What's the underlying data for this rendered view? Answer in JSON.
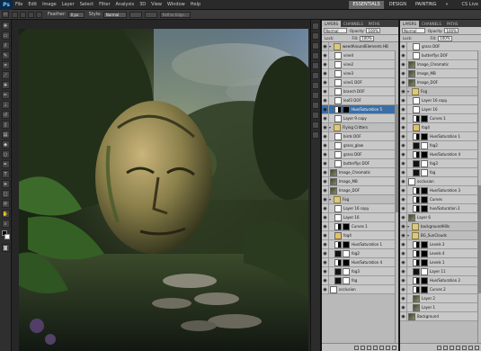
{
  "app": {
    "logo": "Ps",
    "menus": [
      "File",
      "Edit",
      "Image",
      "Layer",
      "Select",
      "Filter",
      "Analysis",
      "3D",
      "View",
      "Window",
      "Help"
    ],
    "workspaces": [
      "ESSENTIALS",
      "DESIGN",
      "PAINTING"
    ],
    "active_workspace": "ESSENTIALS",
    "cslive": "CS Live"
  },
  "options_bar": {
    "feather_label": "Feather:",
    "feather_value": "0 px",
    "style_label": "Style:",
    "style_value": "Normal",
    "refine_label": "Refine Edge..."
  },
  "panel_left": {
    "tabs": [
      "LAYERS",
      "CHANNELS",
      "PATHS"
    ],
    "blend_mode": "Normal",
    "opacity_label": "Opacity:",
    "opacity_value": "100%",
    "lock_label": "Lock:",
    "fill_label": "Fill:",
    "fill_value": "100%",
    "layers": [
      {
        "name": "weedAroundElements HB",
        "kind": "group",
        "depth": 0,
        "thumb": "folder"
      },
      {
        "name": "vine4",
        "kind": "layer",
        "depth": 1,
        "thumb": "white"
      },
      {
        "name": "vine2",
        "kind": "layer",
        "depth": 1,
        "thumb": "white"
      },
      {
        "name": "vine3",
        "kind": "layer",
        "depth": 1,
        "thumb": "white"
      },
      {
        "name": "vine1 DOF",
        "kind": "layer",
        "depth": 1,
        "thumb": "white"
      },
      {
        "name": "branch DOF",
        "kind": "layer",
        "depth": 1,
        "thumb": "white"
      },
      {
        "name": "leaf3 DOF",
        "kind": "layer",
        "depth": 1,
        "thumb": "white"
      },
      {
        "name": "Hue/Saturation 5",
        "kind": "adjust",
        "depth": 1,
        "thumb": "adj",
        "selected": true
      },
      {
        "name": "Layer 9 copy",
        "kind": "layer",
        "depth": 1,
        "thumb": "white"
      },
      {
        "name": "Flying Critters",
        "kind": "group",
        "depth": 0,
        "thumb": "folder"
      },
      {
        "name": "birds DOF",
        "kind": "layer",
        "depth": 1,
        "thumb": "white"
      },
      {
        "name": "grass_glow",
        "kind": "layer",
        "depth": 1,
        "thumb": "white"
      },
      {
        "name": "grass DOF",
        "kind": "layer",
        "depth": 1,
        "thumb": "white"
      },
      {
        "name": "butterflys DOF",
        "kind": "layer",
        "depth": 1,
        "thumb": "white"
      },
      {
        "name": "Image_Chromatic",
        "kind": "layer",
        "depth": 0,
        "thumb": "img"
      },
      {
        "name": "Image_MB",
        "kind": "layer",
        "depth": 0,
        "thumb": "img"
      },
      {
        "name": "Image_DOF",
        "kind": "layer",
        "depth": 0,
        "thumb": "img"
      },
      {
        "name": "Fog",
        "kind": "group",
        "depth": 0,
        "thumb": "folder"
      },
      {
        "name": "Layer 16 copy",
        "kind": "layer",
        "depth": 1,
        "thumb": "white"
      },
      {
        "name": "Layer 16",
        "kind": "layer",
        "depth": 1,
        "thumb": "white"
      },
      {
        "name": "Curves 1",
        "kind": "adjust",
        "depth": 1,
        "thumb": "adj"
      },
      {
        "name": "fog4",
        "kind": "layer",
        "depth": 1,
        "thumb": "yellow"
      },
      {
        "name": "Hue/Saturation 1",
        "kind": "adjust",
        "depth": 1,
        "thumb": "adj"
      },
      {
        "name": "fog2",
        "kind": "layer",
        "depth": 1,
        "thumb": "black"
      },
      {
        "name": "Hue/Saturation 4",
        "kind": "adjust",
        "depth": 1,
        "thumb": "adj"
      },
      {
        "name": "fog3",
        "kind": "layer",
        "depth": 1,
        "thumb": "black"
      },
      {
        "name": "fog",
        "kind": "layer",
        "depth": 1,
        "thumb": "black"
      },
      {
        "name": "occlusion",
        "kind": "layer",
        "depth": 0,
        "thumb": "white"
      }
    ]
  },
  "panel_right": {
    "tabs": [
      "LAYERS",
      "CHANNELS",
      "PATHS"
    ],
    "blend_mode": "Normal",
    "opacity_label": "Opacity:",
    "opacity_value": "100%",
    "lock_label": "Lock:",
    "fill_label": "Fill:",
    "fill_value": "100%",
    "layers": [
      {
        "name": "grass DOF",
        "kind": "layer",
        "depth": 1,
        "thumb": "white"
      },
      {
        "name": "butterflys DOF",
        "kind": "layer",
        "depth": 1,
        "thumb": "white"
      },
      {
        "name": "Image_Chromatic",
        "kind": "layer",
        "depth": 0,
        "thumb": "img"
      },
      {
        "name": "Image_MB",
        "kind": "layer",
        "depth": 0,
        "thumb": "img"
      },
      {
        "name": "Image_DOF",
        "kind": "layer",
        "depth": 0,
        "thumb": "img"
      },
      {
        "name": "Fog",
        "kind": "group",
        "depth": 0,
        "thumb": "folder"
      },
      {
        "name": "Layer 16 copy",
        "kind": "layer",
        "depth": 1,
        "thumb": "white"
      },
      {
        "name": "Layer 16",
        "kind": "layer",
        "depth": 1,
        "thumb": "white"
      },
      {
        "name": "Curves 1",
        "kind": "adjust",
        "depth": 1,
        "thumb": "adj"
      },
      {
        "name": "fog4",
        "kind": "layer",
        "depth": 1,
        "thumb": "yellow"
      },
      {
        "name": "Hue/Saturation 1",
        "kind": "adjust",
        "depth": 1,
        "thumb": "adj"
      },
      {
        "name": "fog2",
        "kind": "layer",
        "depth": 1,
        "thumb": "black"
      },
      {
        "name": "Hue/Saturation 4",
        "kind": "adjust",
        "depth": 1,
        "thumb": "adj"
      },
      {
        "name": "fog3",
        "kind": "layer",
        "depth": 1,
        "thumb": "black"
      },
      {
        "name": "fog",
        "kind": "layer",
        "depth": 1,
        "thumb": "black"
      },
      {
        "name": "occlusion",
        "kind": "layer",
        "depth": 0,
        "thumb": "white"
      },
      {
        "name": "Hue/Saturation 3",
        "kind": "adjust",
        "depth": 1,
        "thumb": "adj"
      },
      {
        "name": "Curves",
        "kind": "adjust",
        "depth": 1,
        "thumb": "adj"
      },
      {
        "name": "hue/Saturation 2",
        "kind": "adjust",
        "depth": 1,
        "thumb": "adj"
      },
      {
        "name": "Layer 6",
        "kind": "layer",
        "depth": 0,
        "thumb": "img"
      },
      {
        "name": "backgroundHills",
        "kind": "group",
        "depth": 0,
        "thumb": "folder"
      },
      {
        "name": "BG_SunClouds",
        "kind": "group",
        "depth": 0,
        "thumb": "folder"
      },
      {
        "name": "Levels 3",
        "kind": "adjust",
        "depth": 1,
        "thumb": "adj"
      },
      {
        "name": "Levels 4",
        "kind": "adjust",
        "depth": 1,
        "thumb": "adj"
      },
      {
        "name": "Levels 1",
        "kind": "adjust",
        "depth": 1,
        "thumb": "adj"
      },
      {
        "name": "Layer 11",
        "kind": "layer",
        "depth": 1,
        "thumb": "black"
      },
      {
        "name": "Hue/Saturation 2",
        "kind": "adjust",
        "depth": 1,
        "thumb": "adj"
      },
      {
        "name": "Curves 2",
        "kind": "adjust",
        "depth": 1,
        "thumb": "adj"
      },
      {
        "name": "Layer 2",
        "kind": "layer",
        "depth": 1,
        "thumb": "img"
      },
      {
        "name": "Layer 1",
        "kind": "layer",
        "depth": 1,
        "thumb": "img"
      },
      {
        "name": "Background",
        "kind": "layer",
        "depth": 0,
        "thumb": "img"
      }
    ]
  },
  "colors": {
    "selected_layer": "#3b6ea5",
    "panel_bg": "#b9b9b9",
    "app_bg": "#1e1e1e"
  }
}
